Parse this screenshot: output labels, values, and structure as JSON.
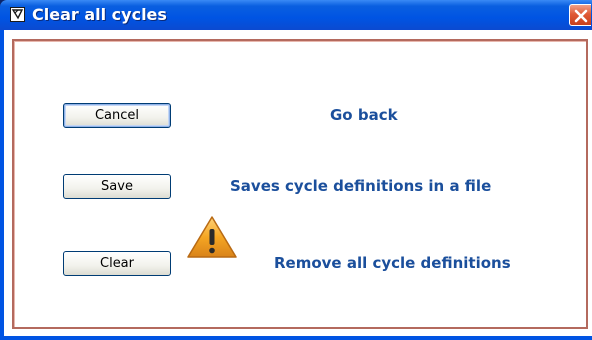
{
  "window": {
    "title": "Clear all cycles",
    "title_icon": "checkbox-pen-icon",
    "close_icon": "close-x-icon"
  },
  "actions": [
    {
      "button_label": "Cancel",
      "description": "Go back"
    },
    {
      "button_label": "Save",
      "description": "Saves cycle definitions in a file"
    },
    {
      "button_label": "Clear",
      "description": "Remove all cycle definitions",
      "icon": "warning-triangle-icon"
    }
  ],
  "colors": {
    "title_bar": "#0054e3",
    "close_button": "#e05a36",
    "description_text": "#1b4f9c",
    "panel_border": "#b46a5e",
    "warning_fill": "#f5a623"
  }
}
